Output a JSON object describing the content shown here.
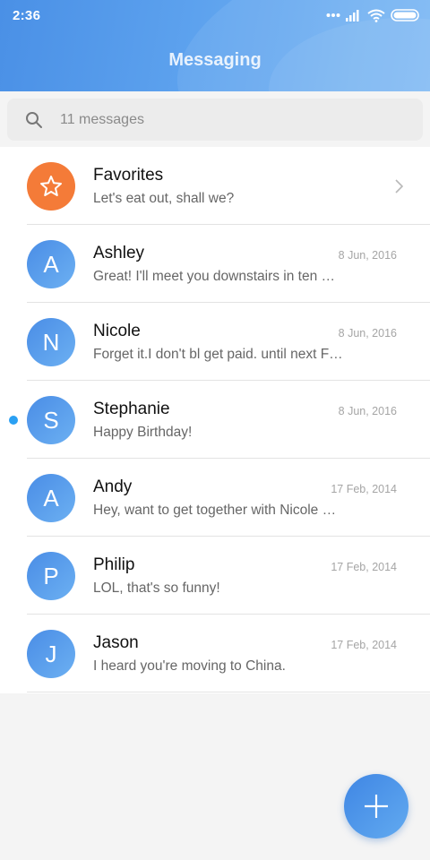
{
  "status_bar": {
    "time": "2:36"
  },
  "header": {
    "title": "Messaging"
  },
  "search": {
    "placeholder": "11 messages"
  },
  "colors": {
    "accent": "#4a90e6",
    "favorite": "#f47b38",
    "unread": "#2aa0f3"
  },
  "favorites": {
    "name": "Favorites",
    "preview": "Let's eat out, shall we?",
    "icon": "star-icon"
  },
  "conversations": [
    {
      "initial": "A",
      "name": "Ashley",
      "date": "8 Jun, 2016",
      "preview": "Great! I'll meet you downstairs in ten …",
      "unread": false
    },
    {
      "initial": "N",
      "name": "Nicole",
      "date": "8 Jun, 2016",
      "preview": "Forget it.I don't bl get paid. until next F…",
      "unread": false
    },
    {
      "initial": "S",
      "name": "Stephanie",
      "date": "8 Jun, 2016",
      "preview": "Happy Birthday!",
      "unread": true
    },
    {
      "initial": "A",
      "name": "Andy",
      "date": "17 Feb, 2014",
      "preview": "Hey, want to get together with Nicole …",
      "unread": false
    },
    {
      "initial": "P",
      "name": "Philip",
      "date": "17 Feb, 2014",
      "preview": "LOL, that's so funny!",
      "unread": false
    },
    {
      "initial": "J",
      "name": "Jason",
      "date": "17 Feb, 2014",
      "preview": "I heard you're moving to China.",
      "unread": false
    }
  ],
  "fab": {
    "icon": "plus-icon"
  }
}
